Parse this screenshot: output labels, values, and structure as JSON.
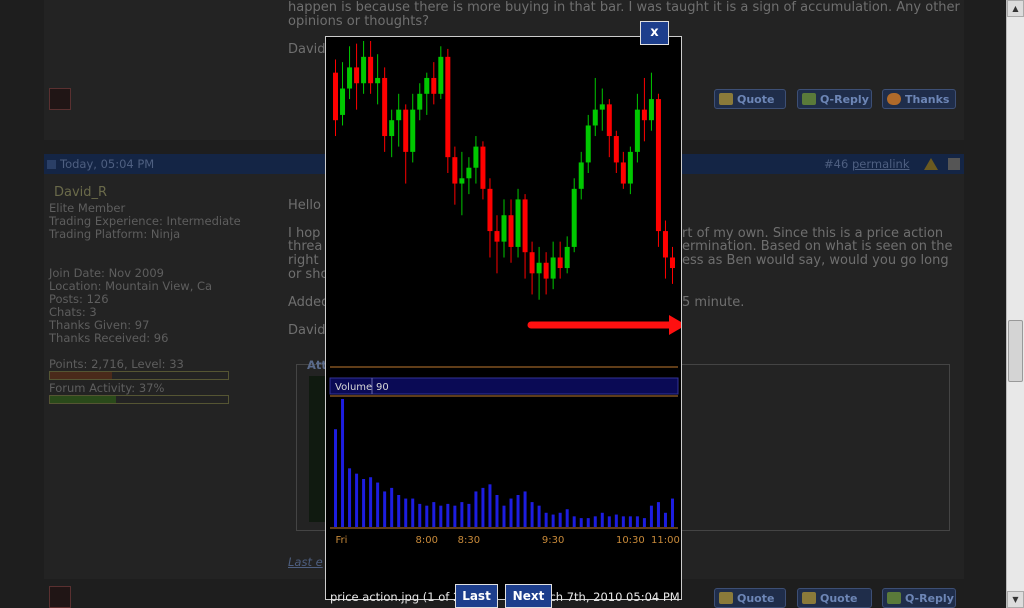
{
  "post1": {
    "text_lines": [
      "happen is because there is more buying in that bar. I was taught it is a sign of accumulation. Any other",
      "opinions or thoughts?"
    ],
    "signature": "David"
  },
  "post_buttons": {
    "quote": "Quote",
    "q_reply": "Q-Reply",
    "thanks": "Thanks"
  },
  "post2": {
    "header_date": "Today, 05:04 PM",
    "post_number": "#46",
    "permalink": "permalink",
    "username": "David_R",
    "user_title": "Elite Member",
    "trading_experience": "Trading Experience: Intermediate",
    "trading_platform": "Trading Platform: Ninja",
    "join_date": "Join Date: Nov 2009",
    "location": "Location: Mountain View, Ca",
    "posts": "Posts: 126",
    "chats": "Chats: 3",
    "thanks_given": "Thanks Given: 97",
    "thanks_received": "Thanks Received: 96",
    "points": "Points: 2,716, Level: 33",
    "points_fraction": 0.35,
    "forum_activity": "Forum Activity: 37%",
    "activity_fraction": 0.37,
    "greeting": "Hello",
    "body_right": [
      "rt of my own. Since this is a price action",
      "ermination. Based on what is seen on the",
      "ess as Ben would say, would you go long"
    ],
    "body_left": [
      "I hop",
      "threa",
      "right",
      "or sho"
    ],
    "added_left": "Added",
    "added_right": "5 minute.",
    "sign_left": "David",
    "attach_label": "Att",
    "last_edit": "Last e"
  },
  "lightbox": {
    "close_label": "x",
    "volume_label": "Volume",
    "volume_value": "90",
    "caption_name": "price action.jpg (1 of 2)",
    "caption_date": "March 7th, 2010 05:04 PM",
    "last_label": "Last",
    "next_label": "Next"
  },
  "colors": {
    "up": "#00c800",
    "down": "#ff0000",
    "volume": "#1d1de0",
    "time_label": "#c88a3a",
    "separator": "#c07a30"
  },
  "chart_data": {
    "type": "candlestick",
    "x_ticks": [
      "Fri",
      "8:00",
      "8:30",
      "9:30",
      "10:30",
      "11:00"
    ],
    "x_tick_positions": [
      0,
      13,
      19,
      31,
      42,
      47
    ],
    "ylim": [
      0,
      100
    ],
    "candles": [
      {
        "o": 88,
        "c": 70,
        "h": 93,
        "l": 64
      },
      {
        "o": 72,
        "c": 82,
        "h": 92,
        "l": 68
      },
      {
        "o": 82,
        "c": 90,
        "h": 98,
        "l": 78
      },
      {
        "o": 90,
        "c": 84,
        "h": 99,
        "l": 74
      },
      {
        "o": 84,
        "c": 94,
        "h": 100,
        "l": 80
      },
      {
        "o": 94,
        "c": 84,
        "h": 100,
        "l": 80
      },
      {
        "o": 84,
        "c": 86,
        "h": 95,
        "l": 76
      },
      {
        "o": 86,
        "c": 64,
        "h": 90,
        "l": 58
      },
      {
        "o": 64,
        "c": 70,
        "h": 74,
        "l": 56
      },
      {
        "o": 70,
        "c": 74,
        "h": 80,
        "l": 60
      },
      {
        "o": 74,
        "c": 58,
        "h": 76,
        "l": 46
      },
      {
        "o": 58,
        "c": 74,
        "h": 80,
        "l": 54
      },
      {
        "o": 74,
        "c": 80,
        "h": 84,
        "l": 70
      },
      {
        "o": 80,
        "c": 86,
        "h": 88,
        "l": 72
      },
      {
        "o": 86,
        "c": 80,
        "h": 92,
        "l": 76
      },
      {
        "o": 80,
        "c": 94,
        "h": 98,
        "l": 78
      },
      {
        "o": 94,
        "c": 56,
        "h": 97,
        "l": 50
      },
      {
        "o": 56,
        "c": 46,
        "h": 60,
        "l": 38
      },
      {
        "o": 46,
        "c": 48,
        "h": 58,
        "l": 34
      },
      {
        "o": 48,
        "c": 52,
        "h": 56,
        "l": 42
      },
      {
        "o": 52,
        "c": 60,
        "h": 64,
        "l": 46
      },
      {
        "o": 60,
        "c": 44,
        "h": 62,
        "l": 40
      },
      {
        "o": 44,
        "c": 28,
        "h": 48,
        "l": 18
      },
      {
        "o": 28,
        "c": 24,
        "h": 34,
        "l": 12
      },
      {
        "o": 24,
        "c": 34,
        "h": 40,
        "l": 18
      },
      {
        "o": 34,
        "c": 22,
        "h": 40,
        "l": 16
      },
      {
        "o": 22,
        "c": 40,
        "h": 44,
        "l": 18
      },
      {
        "o": 40,
        "c": 20,
        "h": 42,
        "l": 10
      },
      {
        "o": 20,
        "c": 12,
        "h": 24,
        "l": 4
      },
      {
        "o": 12,
        "c": 16,
        "h": 22,
        "l": 2
      },
      {
        "o": 16,
        "c": 10,
        "h": 20,
        "l": 4
      },
      {
        "o": 10,
        "c": 18,
        "h": 24,
        "l": 6
      },
      {
        "o": 18,
        "c": 14,
        "h": 24,
        "l": 10
      },
      {
        "o": 14,
        "c": 22,
        "h": 26,
        "l": 12
      },
      {
        "o": 22,
        "c": 44,
        "h": 48,
        "l": 20
      },
      {
        "o": 44,
        "c": 54,
        "h": 58,
        "l": 40
      },
      {
        "o": 54,
        "c": 68,
        "h": 72,
        "l": 50
      },
      {
        "o": 68,
        "c": 74,
        "h": 86,
        "l": 64
      },
      {
        "o": 74,
        "c": 76,
        "h": 82,
        "l": 66
      },
      {
        "o": 76,
        "c": 64,
        "h": 78,
        "l": 56
      },
      {
        "o": 64,
        "c": 54,
        "h": 66,
        "l": 50
      },
      {
        "o": 54,
        "c": 46,
        "h": 58,
        "l": 44
      },
      {
        "o": 46,
        "c": 58,
        "h": 60,
        "l": 42
      },
      {
        "o": 58,
        "c": 74,
        "h": 80,
        "l": 54
      },
      {
        "o": 74,
        "c": 70,
        "h": 86,
        "l": 62
      },
      {
        "o": 70,
        "c": 78,
        "h": 88,
        "l": 66
      },
      {
        "o": 78,
        "c": 28,
        "h": 80,
        "l": 22
      },
      {
        "o": 28,
        "c": 18,
        "h": 32,
        "l": 10
      },
      {
        "o": 18,
        "c": 14,
        "h": 22,
        "l": 8
      }
    ],
    "volume": [
      55,
      72,
      33,
      30,
      27,
      28,
      25,
      20,
      22,
      18,
      16,
      16,
      13,
      12,
      14,
      12,
      13,
      12,
      14,
      13,
      20,
      22,
      24,
      18,
      12,
      16,
      18,
      20,
      14,
      12,
      8,
      7,
      8,
      10,
      6,
      5,
      5,
      6,
      8,
      6,
      7,
      6,
      6,
      6,
      5,
      12,
      14,
      8,
      16
    ]
  }
}
